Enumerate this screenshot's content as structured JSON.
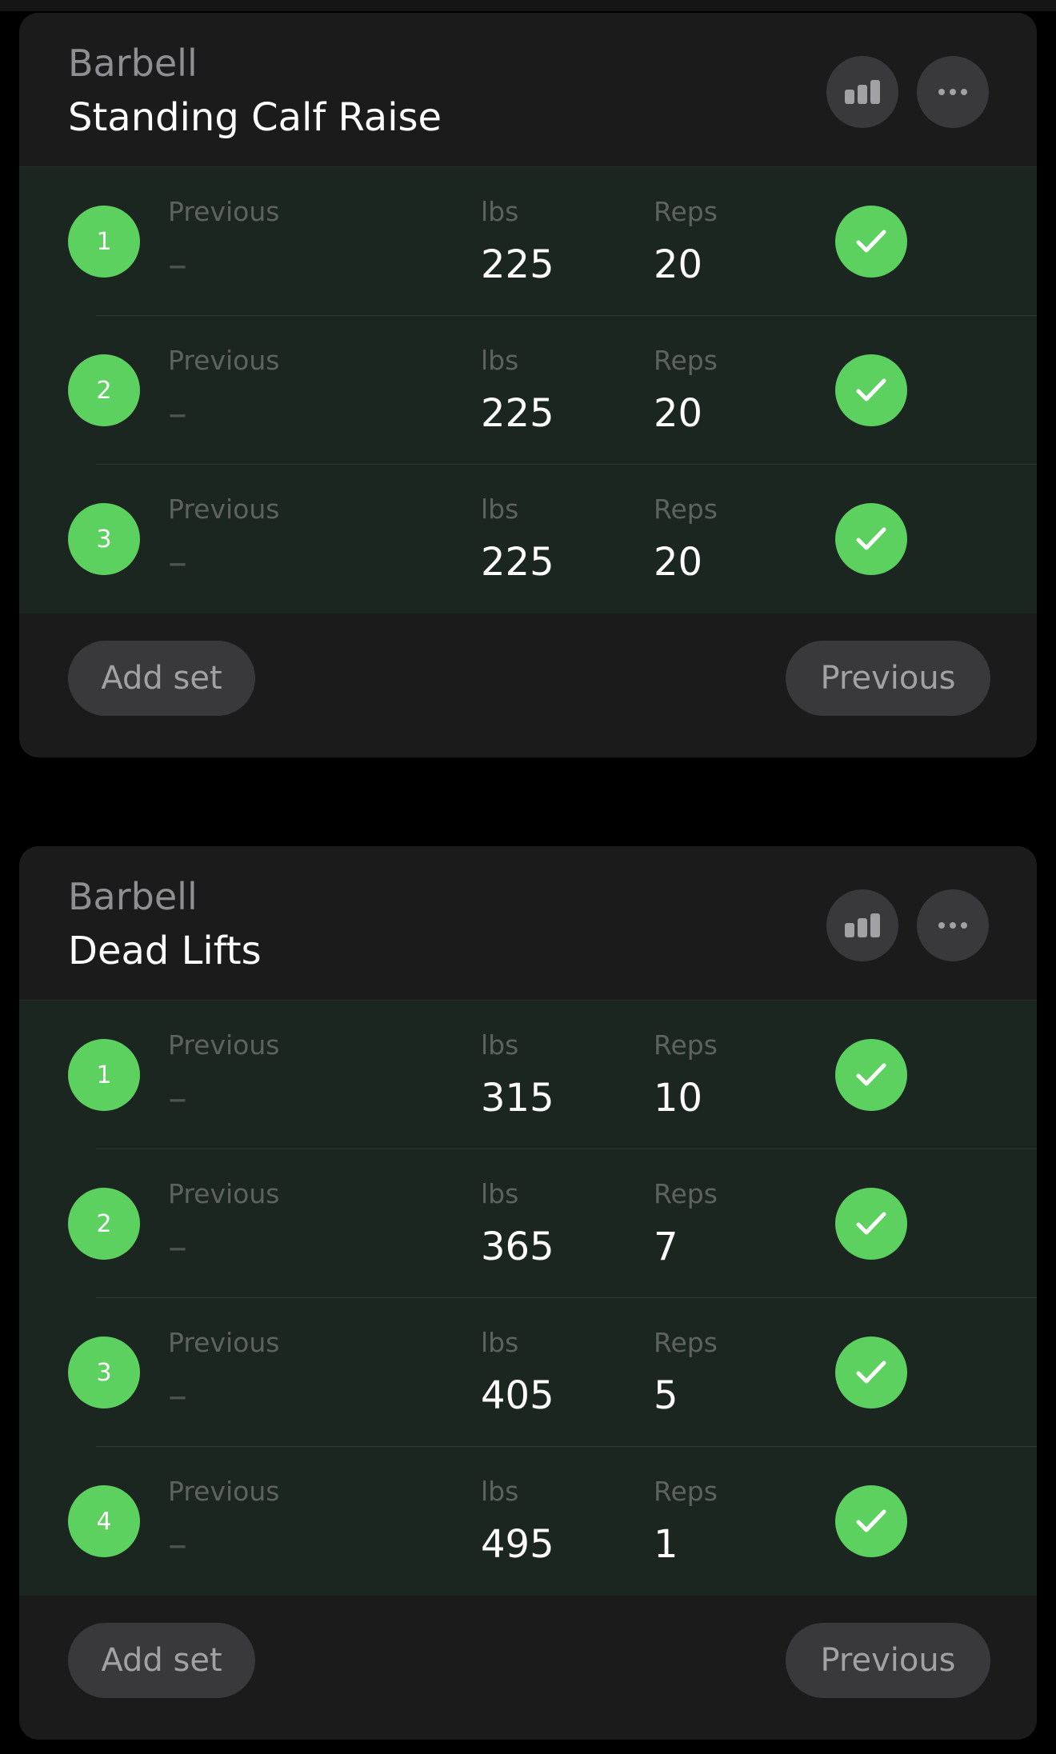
{
  "colors": {
    "background": "#000000",
    "card": "#1b1b1c",
    "completed_row": "#1c2620",
    "accent_green": "#5dd160",
    "button": "#39393c",
    "secondary_text": "#8e8e93"
  },
  "icons": {
    "stats": "bar-chart-icon",
    "more": "ellipsis-icon",
    "complete": "checkmark-icon"
  },
  "exercises": [
    {
      "equipment": "Barbell",
      "name": "Standing Calf Raise",
      "columns": {
        "previous": "Previous",
        "weight": "lbs",
        "reps": "Reps"
      },
      "sets": [
        {
          "number": "1",
          "previous": "–",
          "weight": "225",
          "reps": "20",
          "completed": true
        },
        {
          "number": "2",
          "previous": "–",
          "weight": "225",
          "reps": "20",
          "completed": true
        },
        {
          "number": "3",
          "previous": "–",
          "weight": "225",
          "reps": "20",
          "completed": true
        }
      ],
      "add_set_label": "Add set",
      "previous_button_label": "Previous"
    },
    {
      "equipment": "Barbell",
      "name": "Dead Lifts",
      "columns": {
        "previous": "Previous",
        "weight": "lbs",
        "reps": "Reps"
      },
      "sets": [
        {
          "number": "1",
          "previous": "–",
          "weight": "315",
          "reps": "10",
          "completed": true
        },
        {
          "number": "2",
          "previous": "–",
          "weight": "365",
          "reps": "7",
          "completed": true
        },
        {
          "number": "3",
          "previous": "–",
          "weight": "405",
          "reps": "5",
          "completed": true
        },
        {
          "number": "4",
          "previous": "–",
          "weight": "495",
          "reps": "1",
          "completed": true
        }
      ],
      "add_set_label": "Add set",
      "previous_button_label": "Previous"
    }
  ]
}
